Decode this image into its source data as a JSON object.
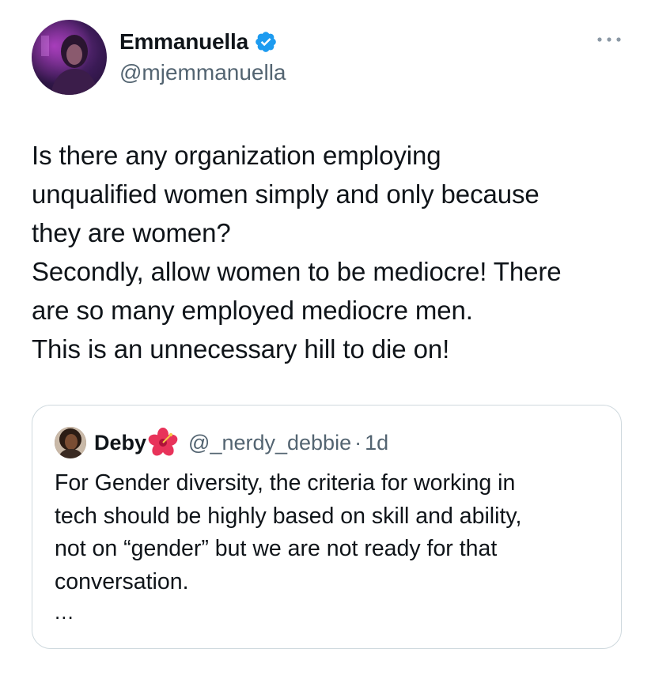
{
  "tweet": {
    "author": {
      "display_name": "Emmanuella",
      "handle": "@mjemmanuella",
      "verified": true,
      "avatar": "profile-photo"
    },
    "more_icon": "more-horizontal-icon",
    "text_lines": [
      "Is there any organization employing",
      "unqualified women simply and only because",
      "they are women?",
      "Secondly, allow women to be mediocre! There",
      "are so many employed mediocre men.",
      "This is an unnecessary hill to die on!"
    ]
  },
  "quote": {
    "author": {
      "display_name": "Deby",
      "emoji": "🌺",
      "handle": "@_nerdy_debbie",
      "separator": "·",
      "time": "1d",
      "avatar": "profile-photo"
    },
    "text_lines": [
      "For Gender diversity, the criteria for working in",
      "tech should be highly based on skill and ability,",
      "not on “gender” but we are not ready for that",
      "conversation."
    ],
    "truncation": "..."
  },
  "colors": {
    "text_primary": "#0f1419",
    "text_secondary": "#536471",
    "verified_blue": "#1d9bf0",
    "border": "#cfd9de"
  }
}
